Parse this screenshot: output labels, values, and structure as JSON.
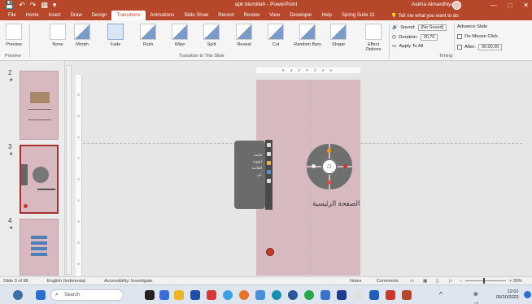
{
  "titlebar": {
    "qat": [
      "💾",
      "↶",
      "↷",
      "▦",
      "▾"
    ],
    "doc_title": "apk bismillah  -  PowerPoint",
    "user": "Asima Almardhiyah",
    "controls": [
      "—",
      "□",
      "✕"
    ]
  },
  "tabs": [
    "File",
    "Home",
    "Insert",
    "Draw",
    "Design",
    "Transitions",
    "Animations",
    "Slide Show",
    "Record",
    "Review",
    "View",
    "Developer",
    "Help",
    "Spring Suite 11"
  ],
  "active_tab": "Transitions",
  "tellme": "Tell me what you want to do",
  "ribbon": {
    "preview_label": "Preview",
    "preview_group": "Preview",
    "transitions_group": "Transition to This Slide",
    "transitions": [
      "None",
      "Morph",
      "Fade",
      "Push",
      "Wipe",
      "Split",
      "Reveal",
      "Cut",
      "Random Bars",
      "Shape"
    ],
    "effect_options": "Effect Options",
    "sound_label": "Sound:",
    "sound_value": "[No Sound]",
    "duration_label": "Duration:",
    "duration_value": "00,70",
    "apply_all": "Apply To All",
    "advance_title": "Advance Slide",
    "on_mouse_click": "On Mouse Click",
    "after_label": "After:",
    "after_value": "00:00,00",
    "timing_group": "Timing"
  },
  "thumbs": [
    {
      "num": "2",
      "star": "★"
    },
    {
      "num": "3",
      "star": "★"
    },
    {
      "num": "4",
      "star": "★"
    }
  ],
  "hruler_text": "6 4 2 0 2 4 6",
  "vruler": [
    "8",
    "6",
    "4",
    "2",
    "0",
    "2",
    "4",
    "6",
    "8"
  ],
  "slide": {
    "menu_items": [
      "قائمة",
      "ايقونة",
      "القائمة",
      "عن"
    ],
    "center_icon": "⌂",
    "home_label": "الصفحة الرئيسية"
  },
  "status": {
    "slide_of": "Slide 3 of 88",
    "language": "English (Indonesia)",
    "accessibility": "Accessibility: Investigate",
    "notes": "Notes",
    "comments": "Comments",
    "zoom": "+ 39%"
  },
  "taskbar": {
    "search": "Search",
    "time": "12:01",
    "date": "09/10/2023"
  }
}
